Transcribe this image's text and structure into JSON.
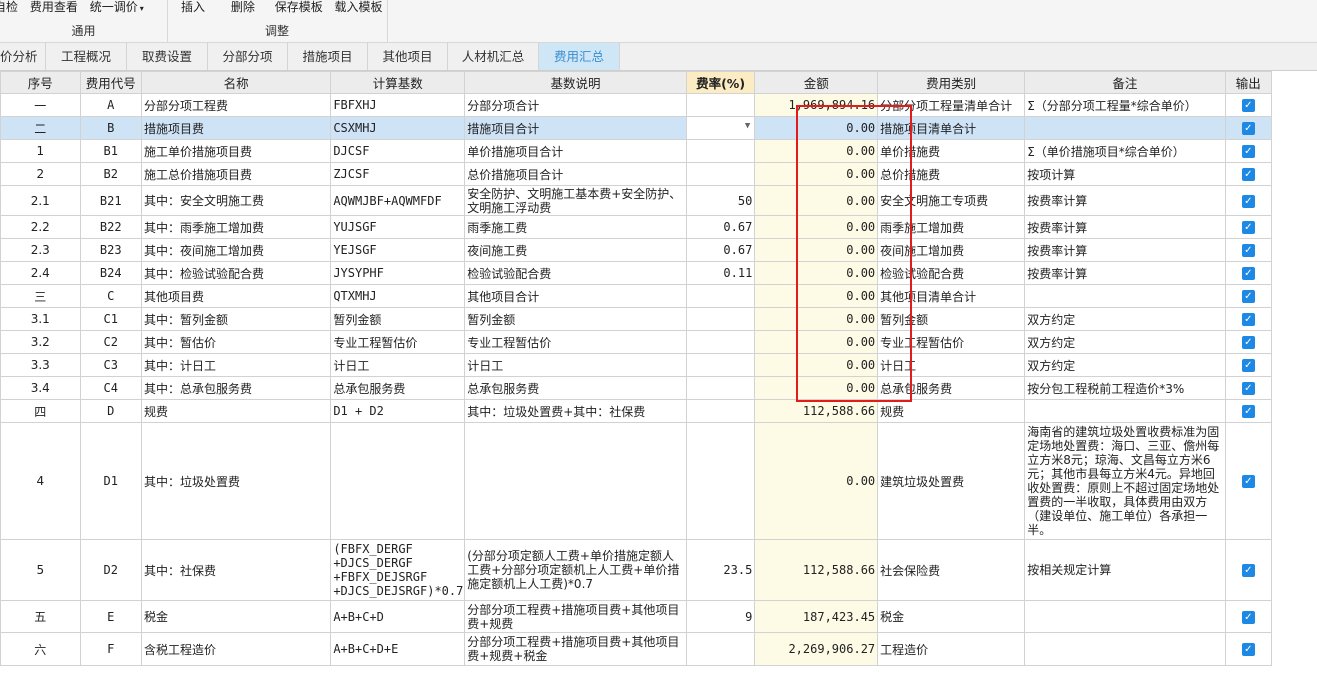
{
  "toolbar": {
    "groups": [
      {
        "caption": "通用",
        "buttons": [
          "自检",
          "费用查看",
          "统一调价"
        ]
      },
      {
        "caption": "调整",
        "buttons": [
          "插入",
          "删除",
          "保存模板",
          "载入模板"
        ]
      }
    ]
  },
  "tabs": [
    "价分析",
    "工程概况",
    "取费设置",
    "分部分项",
    "措施项目",
    "其他项目",
    "人材机汇总",
    "费用汇总"
  ],
  "active_tab": "费用汇总",
  "columns": [
    "序号",
    "费用代号",
    "名称",
    "计算基数",
    "基数说明",
    "费率(%)",
    "金额",
    "费用类别",
    "备注",
    "输出"
  ],
  "rows": [
    {
      "seq": "一",
      "code": "A",
      "name": "分部分项工程费",
      "base": "FBFXHJ",
      "desc": "分部分项合计",
      "rate": "",
      "amount": "1,969,894.16",
      "category": "分部分项工程量清单合计",
      "note": "Σ（分部分项工程量*综合单价）",
      "output": true
    },
    {
      "seq": "二",
      "code": "B",
      "name": "措施项目费",
      "base": "CSXMHJ",
      "desc": "措施项目合计",
      "rate": "",
      "amount": "0.00",
      "category": "措施项目清单合计",
      "note": "",
      "output": true
    },
    {
      "seq": "1",
      "code": "B1",
      "name": "施工单价措施项目费",
      "base": "DJCSF",
      "desc": "单价措施项目合计",
      "rate": "",
      "amount": "0.00",
      "category": "单价措施费",
      "note": "Σ（单价措施项目*综合单价）",
      "output": true
    },
    {
      "seq": "2",
      "code": "B2",
      "name": "施工总价措施项目费",
      "base": "ZJCSF",
      "desc": "总价措施项目合计",
      "rate": "",
      "amount": "0.00",
      "category": "总价措施费",
      "note": "按项计算",
      "output": true
    },
    {
      "seq": "2.1",
      "code": "B21",
      "name": "其中：安全文明施工费",
      "base": "AQWMJBF+AQWMFDF",
      "desc": "安全防护、文明施工基本费+安全防护、文明施工浮动费",
      "rate": "50",
      "amount": "0.00",
      "category": "安全文明施工专项费",
      "note": "按费率计算",
      "output": true
    },
    {
      "seq": "2.2",
      "code": "B22",
      "name": "其中：雨季施工增加费",
      "base": "YUJSGF",
      "desc": "雨季施工费",
      "rate": "0.67",
      "amount": "0.00",
      "category": "雨季施工增加费",
      "note": "按费率计算",
      "output": true
    },
    {
      "seq": "2.3",
      "code": "B23",
      "name": "其中：夜间施工增加费",
      "base": "YEJSGF",
      "desc": "夜间施工费",
      "rate": "0.67",
      "amount": "0.00",
      "category": "夜间施工增加费",
      "note": "按费率计算",
      "output": true
    },
    {
      "seq": "2.4",
      "code": "B24",
      "name": "其中：检验试验配合费",
      "base": "JYSYPHF",
      "desc": "检验试验配合费",
      "rate": "0.11",
      "amount": "0.00",
      "category": "检验试验配合费",
      "note": "按费率计算",
      "output": true
    },
    {
      "seq": "三",
      "code": "C",
      "name": "其他项目费",
      "base": "QTXMHJ",
      "desc": "其他项目合计",
      "rate": "",
      "amount": "0.00",
      "category": "其他项目清单合计",
      "note": "",
      "output": true
    },
    {
      "seq": "3.1",
      "code": "C1",
      "name": "其中：暂列金额",
      "base": "暂列金额",
      "desc": "暂列金额",
      "rate": "",
      "amount": "0.00",
      "category": "暂列金额",
      "note": "双方约定",
      "output": true
    },
    {
      "seq": "3.2",
      "code": "C2",
      "name": "其中：暂估价",
      "base": "专业工程暂估价",
      "desc": "专业工程暂估价",
      "rate": "",
      "amount": "0.00",
      "category": "专业工程暂估价",
      "note": "双方约定",
      "output": true
    },
    {
      "seq": "3.3",
      "code": "C3",
      "name": "其中：计日工",
      "base": "计日工",
      "desc": "计日工",
      "rate": "",
      "amount": "0.00",
      "category": "计日工",
      "note": "双方约定",
      "output": true
    },
    {
      "seq": "3.4",
      "code": "C4",
      "name": "其中：总承包服务费",
      "base": "总承包服务费",
      "desc": "总承包服务费",
      "rate": "",
      "amount": "0.00",
      "category": "总承包服务费",
      "note": "按分包工程税前工程造价*3%",
      "output": true
    },
    {
      "seq": "四",
      "code": "D",
      "name": "规费",
      "base": "D1 + D2",
      "desc": "其中：垃圾处置费+其中：社保费",
      "rate": "",
      "amount": "112,588.66",
      "category": "规费",
      "note": "",
      "output": true
    },
    {
      "seq": "4",
      "code": "D1",
      "name": "其中：垃圾处置费",
      "base": "",
      "desc": "",
      "rate": "",
      "amount": "0.00",
      "category": "建筑垃圾处置费",
      "note": "海南省的建筑垃圾处置收费标准为固定场地处置费：海口、三亚、儋州每立方米8元；琼海、文昌每立方米6元；其他市县每立方米4元。异地回收处置费：原则上不超过固定场地处置费的一半收取，具体费用由双方（建设单位、施工单位）各承担一半。",
      "output": true
    },
    {
      "seq": "5",
      "code": "D2",
      "name": "其中：社保费",
      "base": "(FBFX_DERGF +DJCS_DERGF +FBFX_DEJSRGF +DJCS_DEJSRGF)*0.7",
      "desc": "(分部分项定额人工费+单价措施定额人工费+分部分项定额机上人工费+单价措施定额机上人工费)*0.7",
      "rate": "23.5",
      "amount": "112,588.66",
      "category": "社会保险费",
      "note": "按相关规定计算",
      "output": true
    },
    {
      "seq": "五",
      "code": "E",
      "name": "税金",
      "base": "A+B+C+D",
      "desc": "分部分项工程费+措施项目费+其他项目费+规费",
      "rate": "9",
      "amount": "187,423.45",
      "category": "税金",
      "note": "",
      "output": true
    },
    {
      "seq": "六",
      "code": "F",
      "name": "含税工程造价",
      "base": "A+B+C+D+E",
      "desc": "分部分项工程费+措施项目费+其他项目费+规费+税金",
      "rate": "",
      "amount": "2,269,906.27",
      "category": "工程造价",
      "note": "",
      "output": true
    }
  ],
  "selected_row": 1,
  "colors": {
    "accent": "#1e88e5",
    "selection": "#cfe3f7",
    "annotation": "#e21b1b",
    "amount_bg": "#fdfbe6"
  },
  "icons": {
    "checkbox": "checkbox-checked-icon",
    "dropdown": "dropdown-arrow-icon"
  }
}
